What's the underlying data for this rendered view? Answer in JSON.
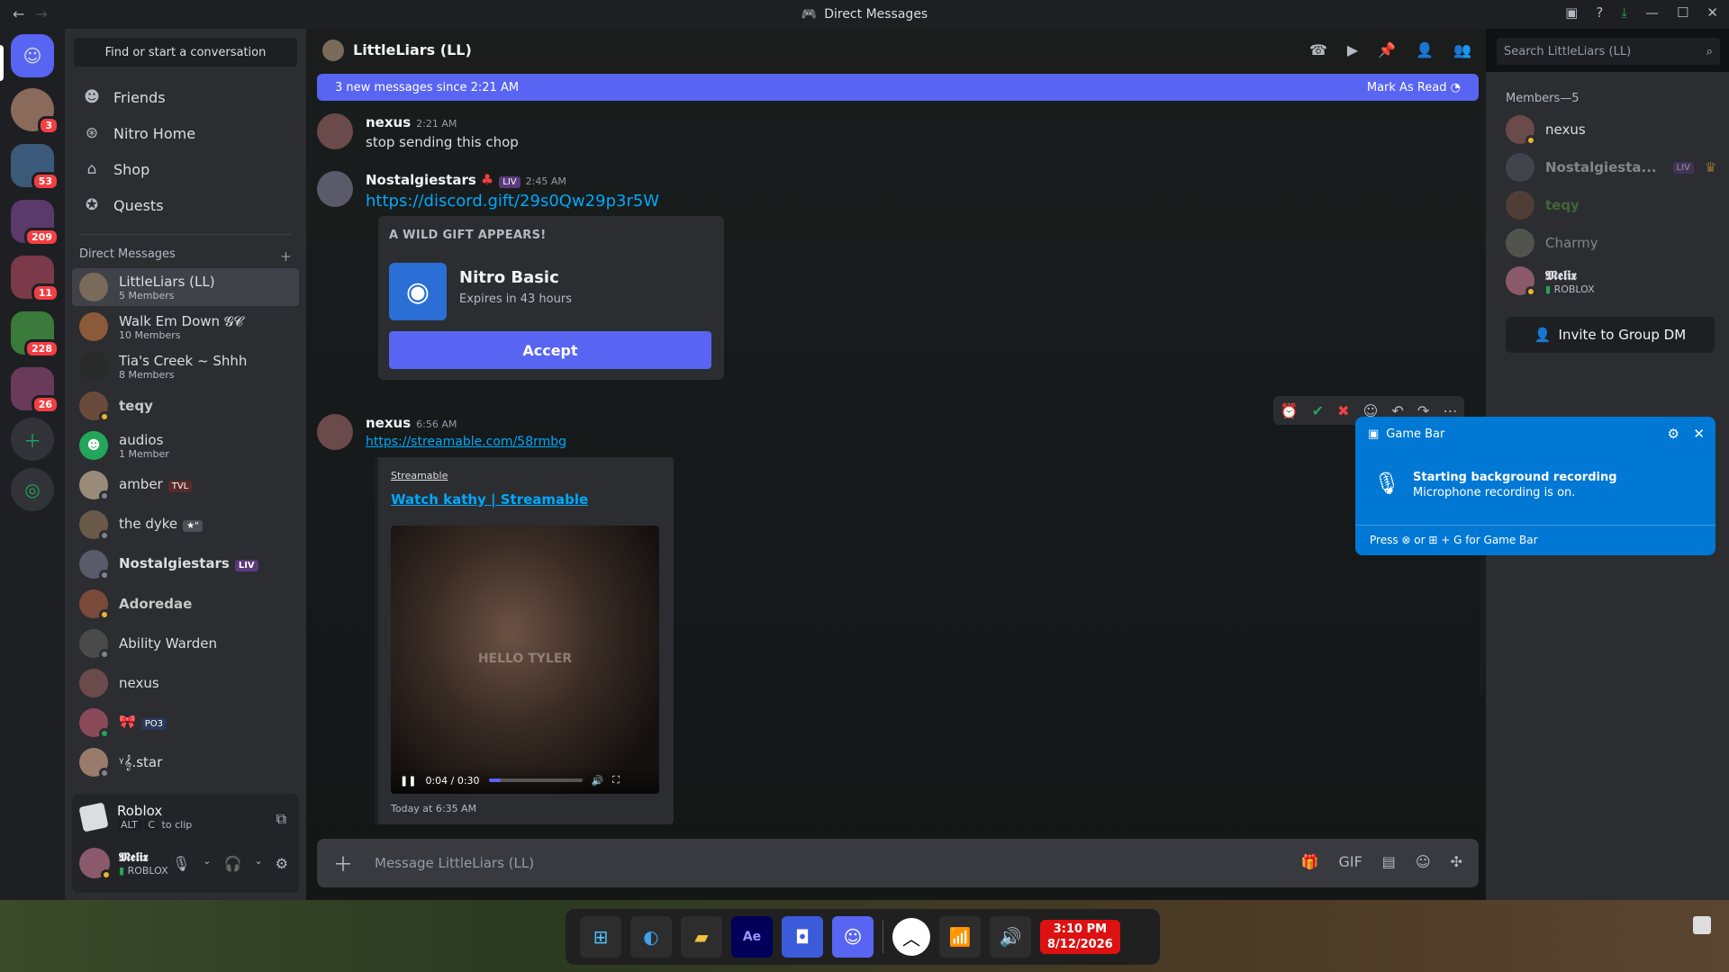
{
  "window": {
    "title": "Direct Messages"
  },
  "search_dm": {
    "placeholder": "Find or start a conversation"
  },
  "nav": [
    {
      "label": "Friends",
      "icon": "friends-icon"
    },
    {
      "label": "Nitro Home",
      "icon": "nitro-icon"
    },
    {
      "label": "Shop",
      "icon": "shop-icon"
    },
    {
      "label": "Quests",
      "icon": "quests-icon"
    }
  ],
  "servers": {
    "badges": [
      "3",
      "53",
      "209",
      "11",
      "228",
      "26"
    ]
  },
  "dm_header": "Direct Messages",
  "dms": [
    {
      "name": "LittleLiars (LL)",
      "sub": "5 Members",
      "selected": true
    },
    {
      "name": "Walk Em Down 𝓖𝓒",
      "sub": "10 Members"
    },
    {
      "name": "Tia's Creek ~ Shhh",
      "sub": "8 Members"
    },
    {
      "name": "teqy",
      "sub": ""
    },
    {
      "name": "audios",
      "sub": "1 Member"
    },
    {
      "name": "amber",
      "sub": "",
      "tag": "TVL"
    },
    {
      "name": "the dyke",
      "sub": "",
      "tag": "★\""
    },
    {
      "name": "Nostalgiestars",
      "sub": "",
      "tag": "LIV"
    },
    {
      "name": "Adoredae",
      "sub": ""
    },
    {
      "name": "Ability Warden",
      "sub": ""
    },
    {
      "name": "nexus",
      "sub": ""
    },
    {
      "name": "🎀",
      "sub": "",
      "tag": "PO3"
    },
    {
      "name": "ᵞ𝄞.star",
      "sub": ""
    }
  ],
  "activity": {
    "game": "Roblox",
    "hint_key1": "ALT",
    "hint_key2": "C",
    "hint_text": "to clip"
  },
  "user": {
    "name": "𝕸𝖊𝖑𝖎𝖝",
    "status": "ROBLOX"
  },
  "chat": {
    "title": "LittleLiars (LL)",
    "search_placeholder": "Search LittleLiars (LL)",
    "new_messages": "3 new messages since 2:21 AM",
    "mark_read": "Mark As Read",
    "input_placeholder": "Message LittleLiars (LL)"
  },
  "messages": [
    {
      "author": "nexus",
      "time": "2:21 AM",
      "text": "stop sending this chop"
    },
    {
      "author": "Nostalgiestars",
      "time": "2:45 AM",
      "tag": "LIV",
      "link": "https://discord.gift/29s0Qw29p3r5W"
    },
    {
      "author": "nexus",
      "time": "6:56 AM",
      "link": "https://streamable.com/58rmbg"
    }
  ],
  "gift": {
    "heading": "A WILD GIFT APPEARS!",
    "name": "Nitro Basic",
    "expires": "Expires in 43 hours",
    "button": "Accept"
  },
  "embed": {
    "provider": "Streamable",
    "title": "Watch kathy | Streamable",
    "caption": "HELLO TYLER",
    "time": "0:04 / 0:30",
    "progress": 0.13,
    "timestamp": "Today at 6:35 AM"
  },
  "members": {
    "header": "Members—5",
    "list": [
      {
        "name": "nexus",
        "color": "#dbdee1"
      },
      {
        "name": "Nostalgiesta...",
        "color": "#6d6f78",
        "tag": "LIV"
      },
      {
        "name": "teqy",
        "color": "#4e8a3e"
      },
      {
        "name": "Charmy",
        "color": "#6d6f78"
      },
      {
        "name": "𝕸𝖊𝖑𝖎𝖝",
        "color": "#dbdee1",
        "sub": "ROBLOX"
      }
    ],
    "invite": "Invite to Group DM"
  },
  "gamebar": {
    "title": "Game Bar",
    "heading": "Starting background recording",
    "body": "Microphone recording is on.",
    "footer": "Press ⊗ or ⊞ + G for Game Bar"
  },
  "clock": {
    "time": "3:10 PM",
    "date": "8/12/2026"
  },
  "colors": {
    "accent": "#5865f2",
    "link": "#00a8fc",
    "badge": "#f23f43",
    "gamebar": "#0078d4"
  }
}
